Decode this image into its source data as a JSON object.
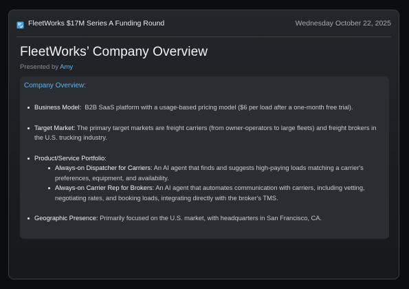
{
  "header": {
    "icon": "document-check-icon",
    "title": "FleetWorks $17M Series A Funding Round",
    "date": "Wednesday October 22, 2025"
  },
  "page": {
    "heading": "FleetWorks’ Company Overview",
    "presented_by_label": "Presented by",
    "presenter": "Amy"
  },
  "overview": {
    "title": "Company Overview:",
    "items": [
      {
        "label": "Business Model:",
        "text": "B2B SaaS platform with a usage-based pricing model ($6 per load after a one-month free trial)."
      },
      {
        "label": "Target Market:",
        "text": "The primary target markets are freight carriers (from owner-operators to large fleets) and freight brokers in the U.S. trucking industry."
      },
      {
        "label": "Product/Service Portfolio:",
        "text": "",
        "subitems": [
          {
            "label": "Always-on Dispatcher for Carriers:",
            "text": "An AI agent that finds and suggests high-paying loads matching a carrier's preferences, equipment, and availability."
          },
          {
            "label": "Always-on Carrier Rep for Brokers:",
            "text": "An AI agent that automates communication with carriers, including vetting, negotiating rates, and booking loads, integrating directly with the broker's TMS."
          }
        ]
      },
      {
        "label": "Geographic Presence:",
        "text": "Primarily focused on the U.S. market, with headquarters in San Francisco, CA."
      }
    ]
  },
  "colors": {
    "accent": "#5fb6e8",
    "background": "#1b1d21",
    "card": "#2a2d32"
  }
}
